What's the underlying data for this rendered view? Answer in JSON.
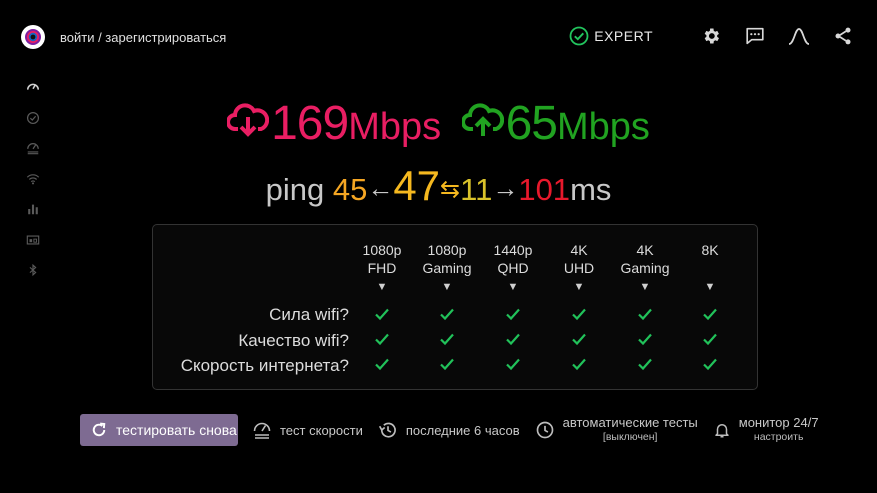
{
  "header": {
    "login_text": "войти / зарегистрироваться",
    "expert_label": "EXPERT",
    "icons": [
      "settings-icon",
      "feedback-icon",
      "graph-icon",
      "share-icon"
    ]
  },
  "sidebar": {
    "icons": [
      "speedometer-icon",
      "check-circle-icon",
      "speed-test-icon",
      "wifi-icon",
      "bar-chart-icon",
      "network-icon",
      "bluetooth-icon"
    ]
  },
  "speed": {
    "download_value": "169",
    "download_unit": "Mbps",
    "upload_value": "65",
    "upload_unit": "Mbps"
  },
  "ping": {
    "label": "ping",
    "min": "45",
    "arrow_left": "←",
    "avg": "47",
    "arrow_both": "⇆",
    "jitter": "11",
    "arrow_right": "→",
    "max": "101",
    "unit": "ms"
  },
  "quality": {
    "columns": [
      {
        "line1": "1080p",
        "line2": "FHD"
      },
      {
        "line1": "1080p",
        "line2": "Gaming"
      },
      {
        "line1": "1440p",
        "line2": "QHD"
      },
      {
        "line1": "4K",
        "line2": "UHD"
      },
      {
        "line1": "4K",
        "line2": "Gaming"
      },
      {
        "line1": "8K",
        "line2": ""
      }
    ],
    "arrow": "▼",
    "rows": [
      {
        "label": "Сила wifi?",
        "checks": [
          true,
          true,
          true,
          true,
          true,
          true
        ]
      },
      {
        "label": "Качество wifi?",
        "checks": [
          true,
          true,
          true,
          true,
          true,
          true
        ]
      },
      {
        "label": "Скорость интернета?",
        "checks": [
          true,
          true,
          true,
          true,
          true,
          true
        ]
      }
    ]
  },
  "actions": {
    "retest_label": "тестировать снова",
    "speedtest_label": "тест скорости",
    "history_label": "последние 6 часов",
    "auto_label": "автоматические тесты",
    "auto_sub": "[выключен]",
    "monitor_label": "монитор 24/7",
    "monitor_sub": "настроить"
  },
  "colors": {
    "download": "#e91e63",
    "upload": "#21a321",
    "ping_min": "#f5a623",
    "ping_avg": "#f5b81f",
    "ping_jitter": "#d9c22b",
    "ping_max": "#e8192c",
    "check": "#21c25a",
    "retest_button": "#7e6b92"
  }
}
